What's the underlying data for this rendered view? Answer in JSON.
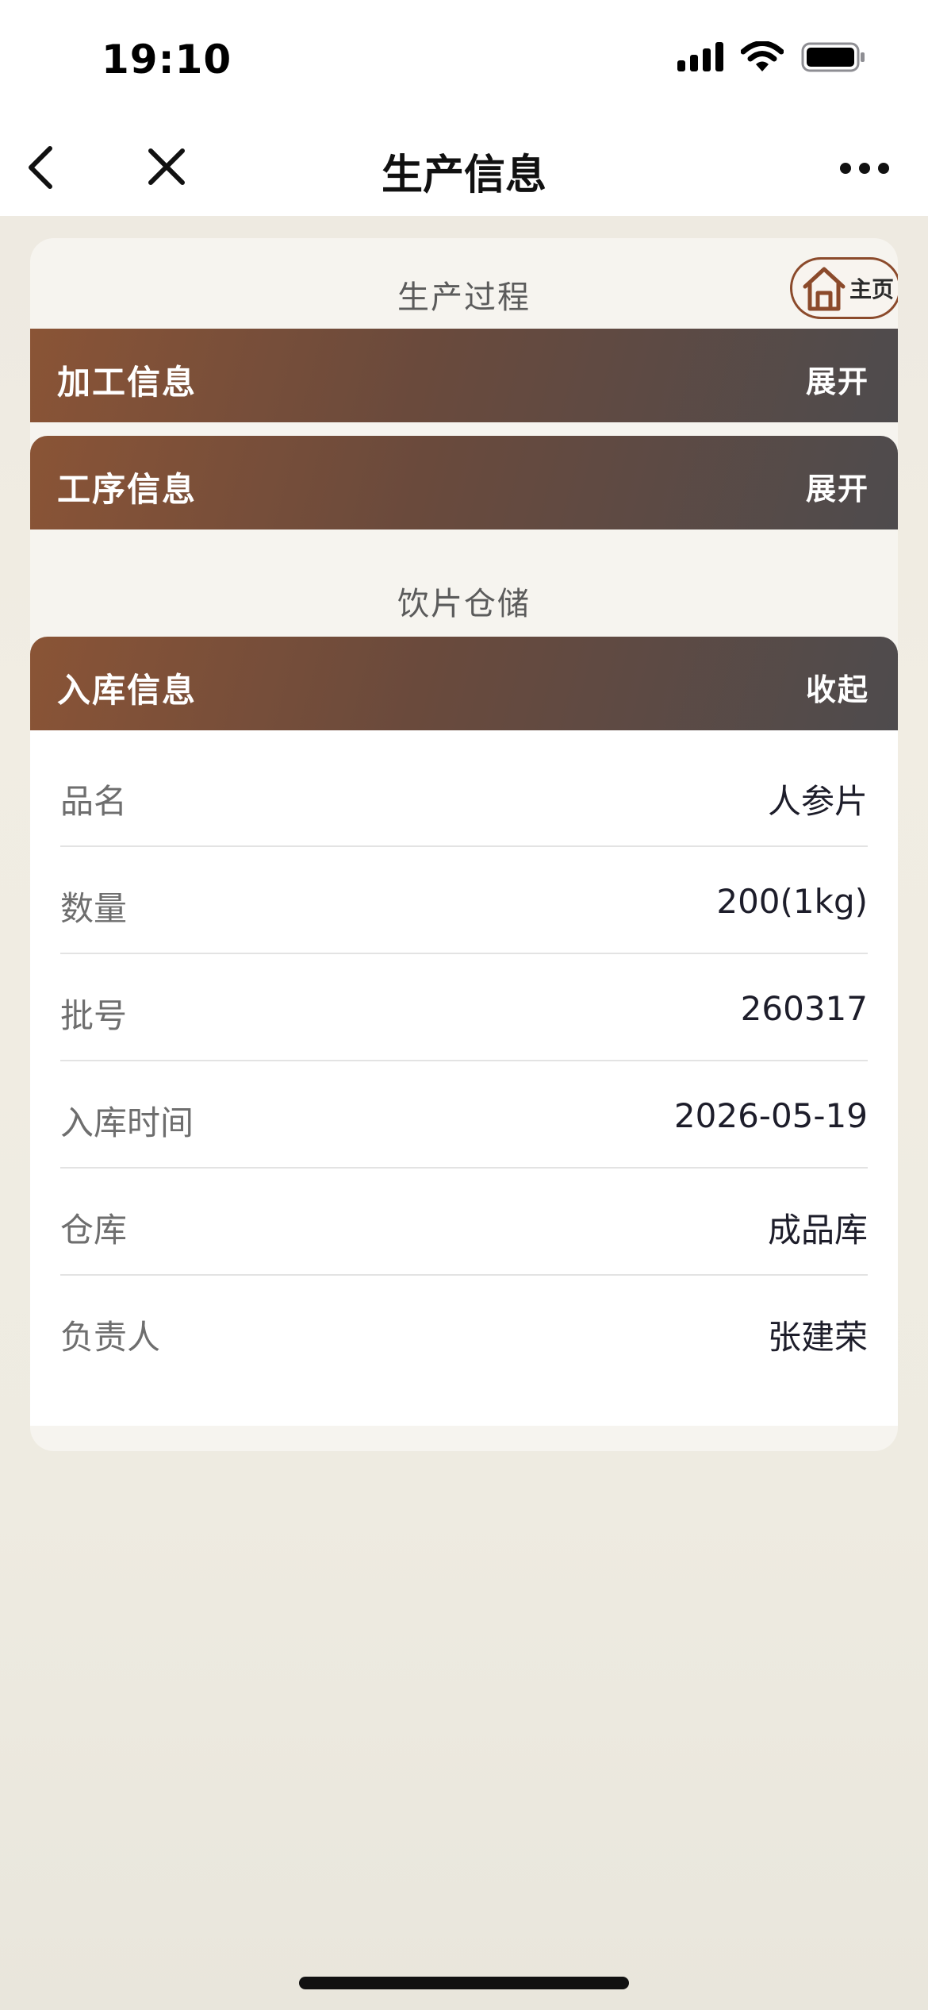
{
  "status_bar": {
    "time": "19:10",
    "icons": [
      "cellular-signal-icon",
      "wifi-icon",
      "battery-icon"
    ]
  },
  "nav": {
    "title": "生产信息",
    "icons": [
      "chevron-left-icon",
      "close-icon",
      "more-icon"
    ]
  },
  "home_button": {
    "label": "主页",
    "icon": "home-icon",
    "accent": "#8b4a2b"
  },
  "sections": {
    "production": {
      "title": "生产过程",
      "panels": [
        {
          "title": "加工信息",
          "toggle": "展开"
        },
        {
          "title": "工序信息",
          "toggle": "展开"
        }
      ]
    },
    "storage": {
      "title": "饮片仓储",
      "panel": {
        "title": "入库信息",
        "toggle": "收起"
      },
      "rows": [
        {
          "label": "品名",
          "value": "人参片"
        },
        {
          "label": "数量",
          "value": "200(1kg)"
        },
        {
          "label": "批号",
          "value": "260317"
        },
        {
          "label": "入库时间",
          "value": "2026-05-19"
        },
        {
          "label": "仓库",
          "value": "成品库"
        },
        {
          "label": "负责人",
          "value": "张建荣"
        }
      ]
    }
  },
  "colors": {
    "header_gradient_start": "#8a5436",
    "header_gradient_end": "#4e4b4d"
  }
}
